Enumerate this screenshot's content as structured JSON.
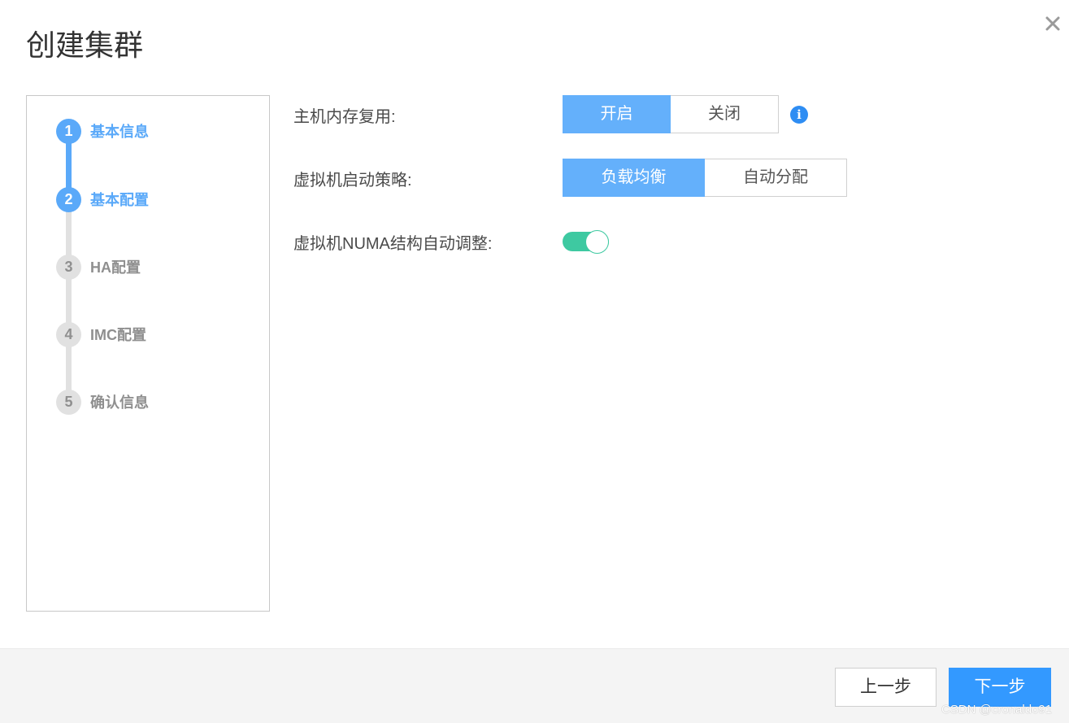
{
  "dialog": {
    "title": "创建集群",
    "close_icon": "close-icon"
  },
  "steps": [
    {
      "number": "1",
      "label": "基本信息",
      "state": "done"
    },
    {
      "number": "2",
      "label": "基本配置",
      "state": "current"
    },
    {
      "number": "3",
      "label": "HA配置",
      "state": "pending"
    },
    {
      "number": "4",
      "label": "IMC配置",
      "state": "pending"
    },
    {
      "number": "5",
      "label": "确认信息",
      "state": "pending"
    }
  ],
  "form": {
    "memory_reuse": {
      "label": "主机内存复用:",
      "options": [
        "开启",
        "关闭"
      ],
      "selected": "开启",
      "info_icon": "info-icon"
    },
    "vm_start_policy": {
      "label": "虚拟机启动策略:",
      "options": [
        "负载均衡",
        "自动分配"
      ],
      "selected": "负载均衡"
    },
    "numa_auto_adjust": {
      "label": "虚拟机NUMA结构自动调整:",
      "enabled": true
    }
  },
  "footer": {
    "prev_label": "上一步",
    "next_label": "下一步"
  },
  "watermark": "CSDN @cronaldo91",
  "colors": {
    "step_active": "#5aa9f9",
    "step_inactive": "#e1e1e1",
    "segment_selected": "#64b0fb",
    "toggle_on": "#3ec9a1",
    "primary_button": "#3399ff",
    "info_icon": "#2e8df3"
  }
}
